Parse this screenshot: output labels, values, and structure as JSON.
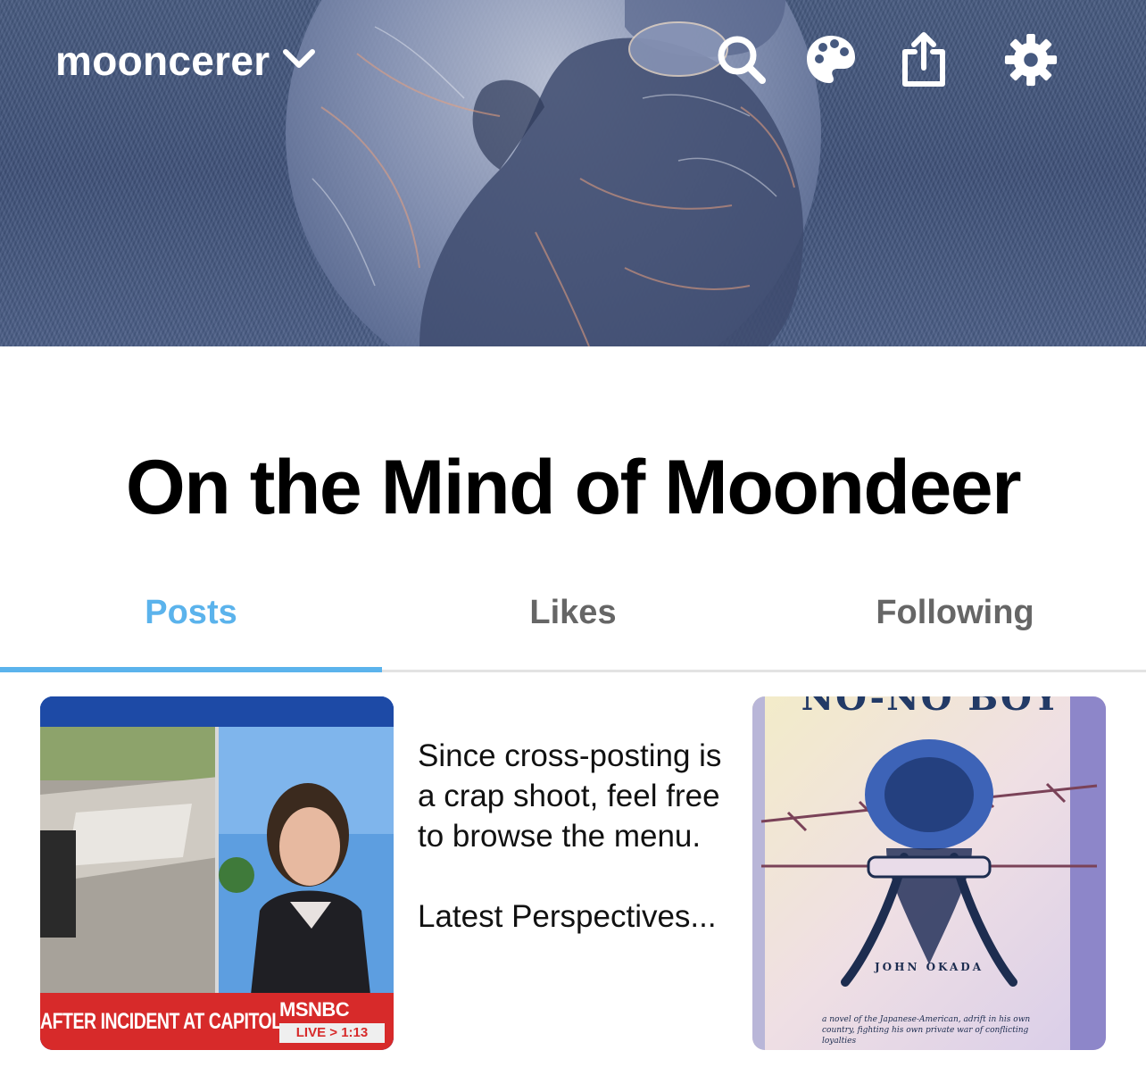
{
  "header": {
    "blog_name": "mooncerer",
    "icons": [
      "chevron-down-icon",
      "search-icon",
      "palette-icon",
      "share-icon",
      "gear-icon"
    ]
  },
  "blog": {
    "title": "On the Mind of Moondeer"
  },
  "tabs": [
    {
      "label": "Posts",
      "active": true
    },
    {
      "label": "Likes",
      "active": false
    },
    {
      "label": "Following",
      "active": false
    }
  ],
  "posts": {
    "news": {
      "headline": "AFTER INCIDENT AT CAPITOL",
      "network": "MSNBC",
      "live": "LIVE > 1:13"
    },
    "text": {
      "body": "Since cross-posting is a crap shoot, feel free to browse the menu.\n\nLatest Perspectives..."
    },
    "book": {
      "title": "NO-NO BOY",
      "author": "JOHN OKADA",
      "blurb": "a novel of the Japanese-American, adrift in his own country, fighting his own private war of conflicting loyalties"
    }
  },
  "colors": {
    "accent": "#5bb3ec",
    "inactive_tab": "#666666",
    "banner": "#46597f"
  }
}
